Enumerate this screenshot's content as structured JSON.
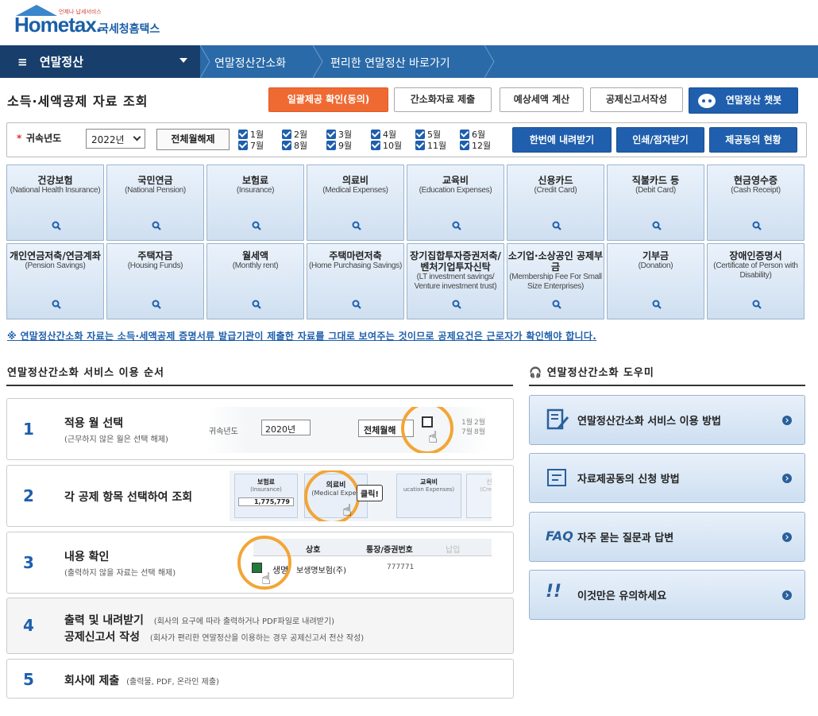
{
  "header": {
    "logo_tagline": "언제나 납세서비스",
    "logo_brand": "Hometax.",
    "logo_korean": "국세청홈택스"
  },
  "nav": {
    "menu_label": "연말정산",
    "crumbs": [
      "연말정산간소화",
      "편리한 연말정산 바로가기"
    ]
  },
  "page": {
    "title": "소득·세액공제 자료 조회",
    "actions": [
      {
        "label": "일괄제공 확인(동의)",
        "style": "orange"
      },
      {
        "label": "간소화자료 제출",
        "style": "white"
      },
      {
        "label": "예상세액 계산",
        "style": "white"
      },
      {
        "label": "공제신고서작성",
        "style": "white"
      },
      {
        "label": "연말정산 챗봇",
        "style": "blue"
      }
    ]
  },
  "filter": {
    "required_mark": "*",
    "year_label": "귀속년도",
    "year_value": "2022년",
    "unselect_label": "전체월해제",
    "months": [
      "1월",
      "2월",
      "3월",
      "4월",
      "5월",
      "6월",
      "7월",
      "8월",
      "9월",
      "10월",
      "11월",
      "12월"
    ],
    "buttons": [
      "한번에 내려받기",
      "인쇄/점자받기",
      "제공동의 현황"
    ]
  },
  "categories": [
    {
      "ko": "건강보험",
      "en": "(National Health Insurance)"
    },
    {
      "ko": "국민연금",
      "en": "(National Pension)"
    },
    {
      "ko": "보험료",
      "en": "(Insurance)"
    },
    {
      "ko": "의료비",
      "en": "(Medical Expenses)"
    },
    {
      "ko": "교육비",
      "en": "(Education Expenses)"
    },
    {
      "ko": "신용카드",
      "en": "(Credit Card)"
    },
    {
      "ko": "직불카드 등",
      "en": "(Debit Card)"
    },
    {
      "ko": "현금영수증",
      "en": "(Cash Receipt)"
    },
    {
      "ko": "개인연금저축/연금계좌",
      "en": "(Pension Savings)"
    },
    {
      "ko": "주택자금",
      "en": "(Housing Funds)"
    },
    {
      "ko": "월세액",
      "en": "(Monthly rent)"
    },
    {
      "ko": "주택마련저축",
      "en": "(Home Purchasing Savings)"
    },
    {
      "ko": "장기집합투자증권저축/벤처기업투자신탁",
      "en": "(LT investment savings/ Venture investment trust)"
    },
    {
      "ko": "소기업·소상공인 공제부금",
      "en": "(Membership Fee For Small Size Enterprises)"
    },
    {
      "ko": "기부금",
      "en": "(Donation)"
    },
    {
      "ko": "장애인증명서",
      "en": "(Certificate of Person with Disability)"
    }
  ],
  "notice": "※ 연말정산간소화 자료는 소득·세액공제 증명서류 발급기관이 제출한 자료를 그대로 보여주는 것이므로 공제요건은 근로자가 확인해야 합니다.",
  "steps": {
    "title": "연말정산간소화 서비스 이용 순서",
    "items": [
      {
        "num": "1",
        "head": "적용 월 선택",
        "sub": "(근무하지 않은 월은 선택 해제)"
      },
      {
        "num": "2",
        "head": "각 공제 항목 선택하여 조회",
        "sub": ""
      },
      {
        "num": "3",
        "head": "내용 확인",
        "sub": "(출력하지 않을 자료는 선택 해제)"
      },
      {
        "num": "4",
        "head": "출력 및 내려받기",
        "head2": "공제신고서 작성",
        "note": "(회사의 요구에 따라 출력하거나 PDF파일로 내려받기)",
        "note2": "(회사가 편리한 연말정산을 이용하는 경우 공제신고서 전산 작성)"
      },
      {
        "num": "5",
        "head": "회사에 제출",
        "note": "(출력물, PDF, 온라인 제출)"
      }
    ],
    "illus1": {
      "year_label": "귀속년도",
      "year": "2020년",
      "unselect": "전체월해",
      "m1": "1월",
      "m2": "2월",
      "m7": "7월",
      "m8": "8월"
    },
    "illus2": {
      "t1": "보험료",
      "t1en": "(Insurance)",
      "t1val": "1,775,779",
      "t2": "의료비",
      "t2en": "(Medical Expen",
      "click": "클릭!",
      "t3": "교육비",
      "t3en": "ucation Expenses)",
      "t4": "신용카드",
      "t4en": "(Credit Card)"
    },
    "illus3": {
      "col1": "상호",
      "col2": "통장/증권번호",
      "col3": "납입",
      "row_name": "생명",
      "row_co": "보생명보험(주)",
      "row_no": "777771"
    }
  },
  "helper": {
    "title": "연말정산간소화 도우미",
    "items": [
      {
        "label": "연말정산간소화 서비스 이용 방법",
        "icon": "document-pen-icon"
      },
      {
        "label": "자료제공동의 신청 방법",
        "icon": "document-icon"
      },
      {
        "label": "자주 묻는 질문과 답변",
        "icon": "faq-icon",
        "icon_text": "FAQ"
      },
      {
        "label": "이것만은 유의하세요",
        "icon": "exclamation-icon",
        "icon_text": "!!"
      }
    ]
  }
}
